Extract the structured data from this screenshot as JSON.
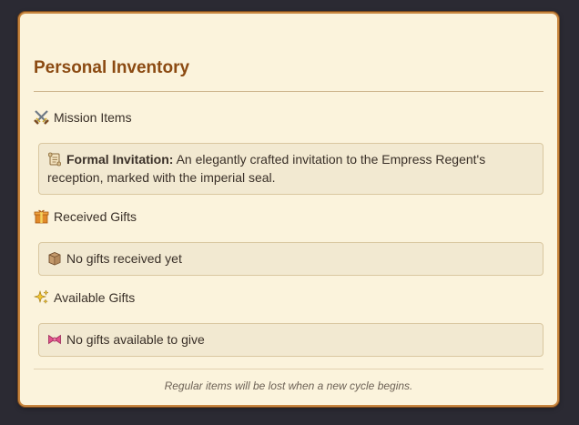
{
  "inventory": {
    "title": "Personal Inventory",
    "mission_items": {
      "heading": "Mission Items",
      "icon": "crossed-swords-icon",
      "items": [
        {
          "icon": "scroll-icon",
          "name": "Formal Invitation:",
          "description": "An elegantly crafted invitation to the Empress Regent's reception, marked with the imperial seal."
        }
      ]
    },
    "received_gifts": {
      "heading": "Received Gifts",
      "icon": "gift-icon",
      "empty_icon": "box-icon",
      "empty_text": "No gifts received yet"
    },
    "available_gifts": {
      "heading": "Available Gifts",
      "icon": "sparkles-icon",
      "empty_icon": "ribbon-icon",
      "empty_text": "No gifts available to give"
    },
    "footer_note": "Regular items will be lost when a new cycle begins."
  },
  "colors": {
    "background": "#2b2a33",
    "panel": "#fbf3dc",
    "panel_border": "#c8863f",
    "title": "#8b4a12",
    "card": "#f2e9d1",
    "card_border": "#d9c7a0",
    "text": "#3a3028"
  }
}
